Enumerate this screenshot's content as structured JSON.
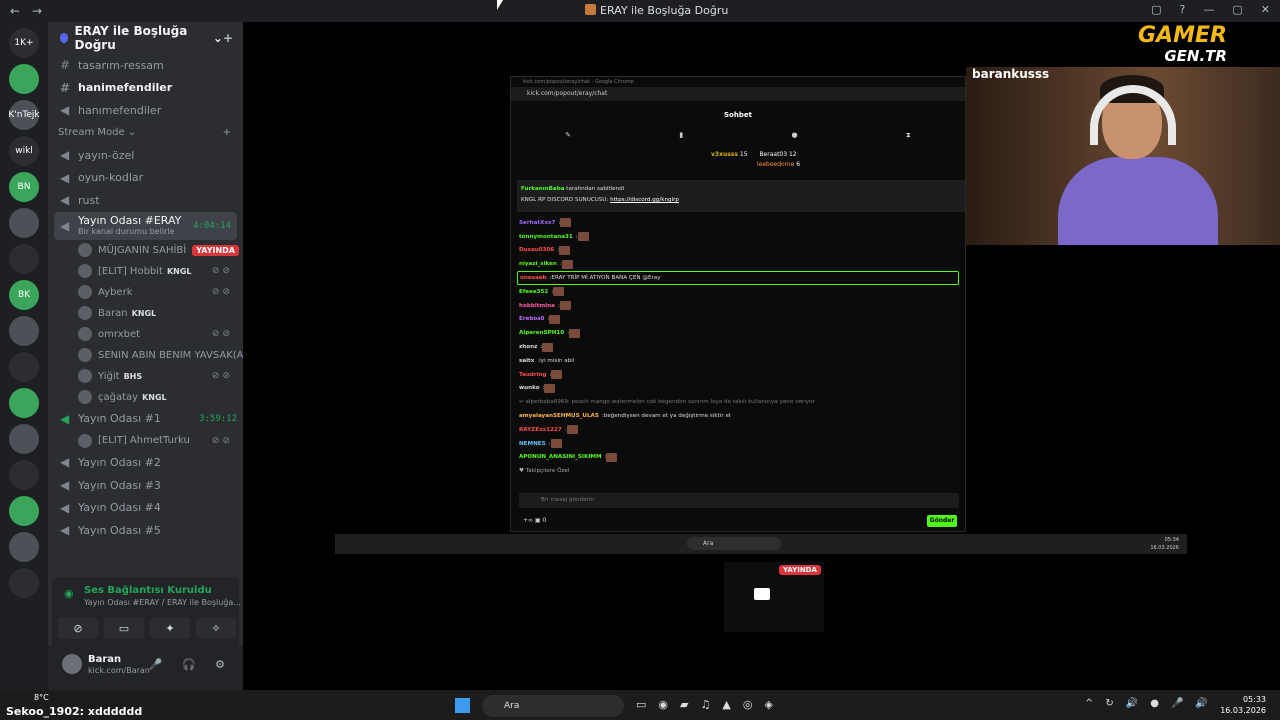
{
  "window": {
    "title": "ERAY ile Boşluğa Doğru",
    "back": "←",
    "forward": "→",
    "controls": [
      "▢",
      "?",
      "—",
      "▢",
      "✕"
    ]
  },
  "guilds": [
    "1K+",
    "",
    "K'nTejk",
    "wikl",
    "BN",
    "",
    "",
    "BK",
    "",
    "",
    "",
    "",
    "",
    "",
    "",
    ""
  ],
  "server": {
    "name": "ERAY ile Boşluğa Doğru",
    "chevron": "⌄",
    "add_icon": "+"
  },
  "channels": {
    "top": [
      {
        "label": "tasarım-ressam",
        "bold": false,
        "kind": "text"
      },
      {
        "label": "hanimefendiler",
        "bold": true,
        "kind": "text"
      },
      {
        "label": "hanımefendiler",
        "bold": false,
        "kind": "voice"
      }
    ],
    "category": "Stream Mode",
    "category_chevron": "⌄",
    "category_plus": "+",
    "stream": [
      {
        "label": "yayın-özel",
        "kind": "voice"
      },
      {
        "label": "oyun-kodlar",
        "kind": "voice"
      },
      {
        "label": "rust",
        "kind": "voice"
      }
    ],
    "active_room": {
      "label": "Yayın Odası #ERAY",
      "time": "4:04:14",
      "status": "Bir kanal durumu belirle"
    },
    "active_users": [
      {
        "name": "MÜJGANIN SAHİBİ",
        "tag": "",
        "live": "YAYINDA",
        "mute": ""
      },
      {
        "name": "[ELIT] Hobbit",
        "tag": "KNGL",
        "live": "",
        "mute": "⊘⊘"
      },
      {
        "name": "Ayberk",
        "tag": "",
        "live": "",
        "mute": "⊘⊘"
      },
      {
        "name": "Baran",
        "tag": "KNGL",
        "live": "",
        "mute": ""
      },
      {
        "name": "omrxbet",
        "tag": "",
        "live": "",
        "mute": "⊘⊘"
      },
      {
        "name": "SENIN ABIN BENIM YAVSAK(A...",
        "tag": "",
        "live": "",
        "mute": ""
      },
      {
        "name": "Yiğit",
        "tag": "BHS",
        "live": "",
        "mute": "⊘⊘"
      },
      {
        "name": "çağatay",
        "tag": "KNGL",
        "live": "",
        "mute": ""
      }
    ],
    "room1": {
      "label": "Yayın Odası #1",
      "time": "3:59:12"
    },
    "room1_users": [
      {
        "name": "[ELIT] AhmetTurku",
        "mute": "⊘⊘"
      }
    ],
    "more_rooms": [
      "Yayın Odası #2",
      "Yayın Odası #3",
      "Yayın Odası #4",
      "Yayın Odası #5"
    ]
  },
  "voice_panel": {
    "status": "Ses Bağlantısı Kuruldu",
    "sub": "Yayın Odası #ERAY / ERAY ile Boşluğa...",
    "buttons": [
      "⊘",
      "▭",
      "✦",
      "✧"
    ]
  },
  "user_panel": {
    "name": "Baran",
    "sub": "kick.com/Baran",
    "controls": "🎤 🎧 ⚙"
  },
  "watermark": {
    "top": "GAMER",
    "bottom": "GEN.TR"
  },
  "cam": {
    "name": "barankusss"
  },
  "stream_window": {
    "tab": "kick.com/popout/eray/chat - Google Chrome",
    "url": "kick.com/popout/eray/chat",
    "heading": "Sohbet",
    "toolbar": [
      "✎",
      "▮",
      "●",
      "⧗"
    ],
    "gifters": [
      {
        "name": "v3xusss",
        "count": "15"
      },
      {
        "name": "Beraat03",
        "count": "12"
      },
      {
        "name": "leebeedome",
        "count": "6"
      }
    ],
    "pinned_by": "FurkanınBaba",
    "pinned_note": "tarafından sabitlendi",
    "pinned_text": "KNGL RP DISCORD SUNUCUSU:",
    "pinned_link": "https://discord.gg/knglrp",
    "messages": [
      {
        "user": "SerhatXxx7",
        "text": "",
        "color": "#9b6bff"
      },
      {
        "user": "tonnymontana31",
        "text": "",
        "color": "#53fc18"
      },
      {
        "user": "Dusau0306",
        "text": "",
        "color": "#ff4d4d"
      },
      {
        "user": "niyazi_siken",
        "text": "",
        "color": "#53fc18"
      },
      {
        "user": "onesaeb",
        "text": "ERAY TRİP Mİ ATIYON BANA ÇEN @Eray",
        "color": "#ff4d4d"
      },
      {
        "user": "Efeee352",
        "text": "",
        "color": "#53fc18"
      },
      {
        "user": "hobbitmina",
        "text": "",
        "color": "#ff5ca8"
      },
      {
        "user": "Erebos0",
        "text": "",
        "color": "#c36bff"
      },
      {
        "user": "AlperenSPH10",
        "text": "",
        "color": "#53fc18"
      },
      {
        "user": "zhonz",
        "text": "",
        "color": "#ddd"
      },
      {
        "user": "saitx",
        "text": "iyi misin abii",
        "color": "#ddd"
      },
      {
        "user": "Taudring",
        "text": "",
        "color": "#ff4d4d"
      },
      {
        "user": "wunko",
        "text": "",
        "color": "#ddd"
      },
      {
        "user": "",
        "text": "↩ alperbaba6969: peach mango watermelon cok begendim sanırım loya da takılı kullanıcıya yanıt veriyor",
        "color": "#777"
      },
      {
        "user": "amyalayanSEHMUS_ULAS",
        "text": "beğendiysen devam et ya değiştirme siktir et",
        "color": "#ffb347"
      },
      {
        "user": "RAYZExx1227",
        "text": "",
        "color": "#ff4d4d"
      },
      {
        "user": "NEMNES",
        "text": "",
        "color": "#5ec8ff"
      },
      {
        "user": "APONUN_ANASINI_SIKIMM",
        "text": "",
        "color": "#53fc18"
      }
    ],
    "followers": "♥ Takipçilere Özel",
    "input_placeholder": "Bir mesaj gönderin",
    "bottom_left": "+∞   ▣ 0",
    "send": "Gönder"
  },
  "inner_taskbar": {
    "search": "Ara",
    "time": "05:34",
    "date": "16.03.2026"
  },
  "preview": {
    "live": "YAYINDA"
  },
  "taskbar": {
    "temp": "8°C",
    "overlay": "Sekoo_1902: xdddddd",
    "search": "Ara",
    "apps": [
      "▭",
      "◉",
      "▰",
      "♫",
      "▲",
      "◎",
      "◈"
    ],
    "tray": [
      "^",
      "↻",
      "🔊",
      "●",
      "🎤",
      "🔊"
    ],
    "time": "05:33",
    "date": "16.03.2026"
  }
}
